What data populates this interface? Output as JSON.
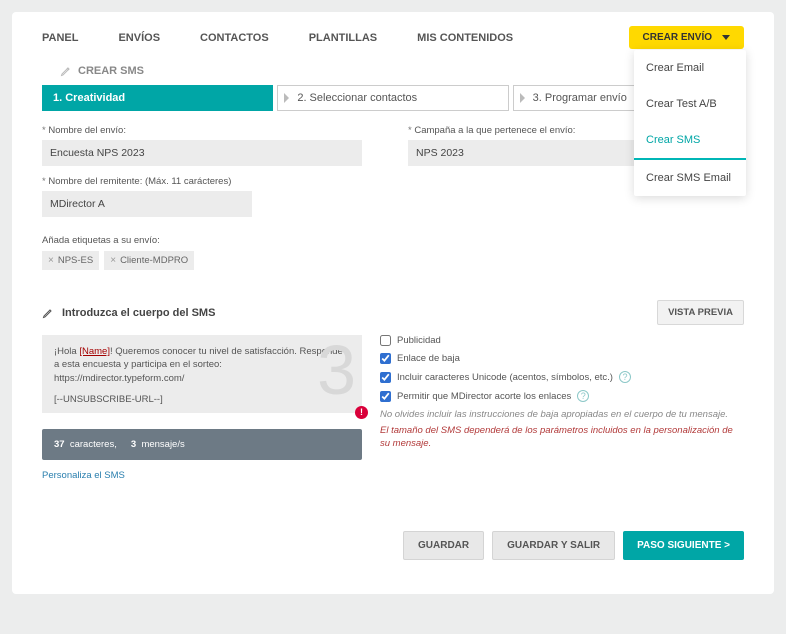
{
  "nav": {
    "items": [
      "PANEL",
      "ENVÍOS",
      "CONTACTOS",
      "PLANTILLAS",
      "MIS CONTENIDOS"
    ],
    "create_btn": "CREAR ENVÍO"
  },
  "dropdown": {
    "items": [
      "Crear Email",
      "Crear Test A/B",
      "Crear SMS",
      "Crear SMS Email"
    ],
    "active_index": 2
  },
  "section_title": "CREAR SMS",
  "steps": {
    "s1": "1. Creatividad",
    "s2": "2. Seleccionar contactos",
    "s3": "3. Programar envío"
  },
  "form": {
    "name_label": "Nombre del envío:",
    "name_value": "Encuesta NPS 2023",
    "campaign_label": "Campaña a la que pertenece el envío:",
    "campaign_value": "NPS 2023",
    "sender_label": "Nombre del remitente: (Máx. 11 carácteres)",
    "sender_value": "MDirector A",
    "tags_label": "Añada etiquetas a su envío:",
    "tags": [
      "NPS-ES",
      "Cliente-MDPRO"
    ]
  },
  "sms": {
    "title": "Introduzca el cuerpo del SMS",
    "preview_btn": "VISTA PREVIA",
    "body_prefix": "¡Hola ",
    "body_name": "[Name]",
    "body_rest": "! Queremos conocer tu nivel de satisfacción. Responde a esta encuesta y participa en el sorteo: https://mdirector.typeform.com/",
    "unsubscribe": "[--UNSUBSCRIBE-URL--]",
    "big_number": "3",
    "warn_badge": "!",
    "counter_chars_num": "37",
    "counter_chars_label": "caracteres,",
    "counter_msgs_num": "3",
    "counter_msgs_label": "mensaje/s",
    "personalize": "Personaliza el SMS",
    "opts": {
      "publicidad": "Publicidad",
      "enlace_baja": "Enlace de baja",
      "unicode": "Incluir caracteres Unicode (acentos, símbolos, etc.)",
      "acortar": "Permitir que MDirector acorte los enlaces"
    },
    "note1": "No olvides incluir las instrucciones de baja apropiadas en el cuerpo de tu mensaje.",
    "note2": "El tamaño del SMS dependerá de los parámetros incluidos en la personalización de su mensaje."
  },
  "buttons": {
    "save": "GUARDAR",
    "save_exit": "GUARDAR Y SALIR",
    "next": "PASO SIGUIENTE >"
  }
}
